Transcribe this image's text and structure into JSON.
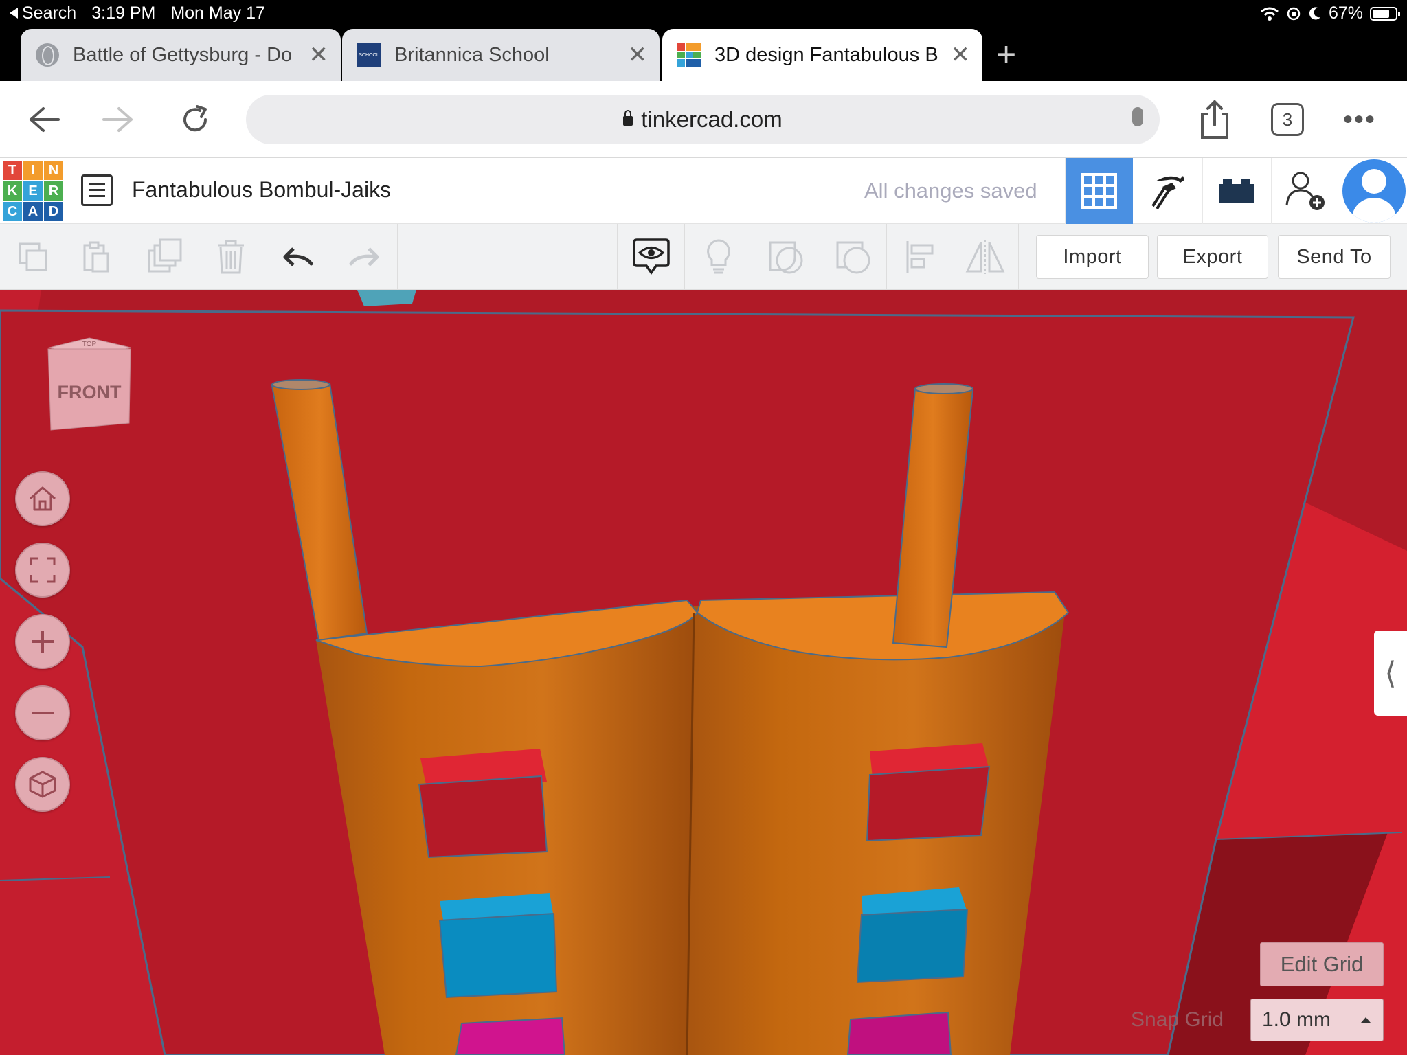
{
  "status_bar": {
    "back_app": "Search",
    "time": "3:19 PM",
    "date": "Mon May 17",
    "battery": "67%"
  },
  "tabs": [
    {
      "title": "Battle of Gettysburg - Do",
      "favicon": "globe-icon",
      "active": false
    },
    {
      "title": "Britannica School",
      "favicon": "britannica-favicon",
      "active": false
    },
    {
      "title": "3D design Fantabulous B",
      "favicon": "tinkercad-favicon",
      "active": true
    }
  ],
  "address_bar": {
    "url": "tinkercad.com",
    "tab_count": "3"
  },
  "tinkercad": {
    "logo_letters": [
      "T",
      "I",
      "N",
      "K",
      "E",
      "R",
      "C",
      "A",
      "D"
    ],
    "logo_colors": [
      "#e2473a",
      "#f39c2c",
      "#f39c2c",
      "#4caf50",
      "#35a3d9",
      "#4caf50",
      "#35a3d9",
      "#1f5fa8",
      "#1f5fa8"
    ],
    "design_title": "Fantabulous Bombul-Jaiks",
    "save_status": "All changes saved",
    "header_buttons": [
      "3d-view-grid-icon",
      "pickaxe-icon",
      "bricks-icon",
      "add-user-icon",
      "user-avatar"
    ]
  },
  "edit_toolbar": {
    "tools": [
      "copy-icon",
      "paste-icon",
      "duplicate-icon",
      "delete-icon",
      "undo-icon",
      "redo-icon"
    ],
    "view_tools": [
      "notes-visibility-icon",
      "lightbulb-icon",
      "group-shape-icon",
      "hole-shape-icon",
      "align-icon",
      "mirror-icon"
    ],
    "import_label": "Import",
    "export_label": "Export",
    "send_to_label": "Send To"
  },
  "workplane": {
    "viewcube_face": "FRONT",
    "viewcube_top": "TOP",
    "nav_buttons": [
      "home-view-icon",
      "fit-all-icon",
      "zoom-in-icon",
      "zoom-out-icon",
      "orthographic-icon"
    ],
    "edit_grid_label": "Edit Grid",
    "snap_grid_label": "Snap Grid",
    "snap_grid_value": "1.0 mm"
  },
  "colors": {
    "workplane_red": "#b01a27",
    "shape_orange": "#e07c1e",
    "accent_blue": "#4a90e2"
  }
}
